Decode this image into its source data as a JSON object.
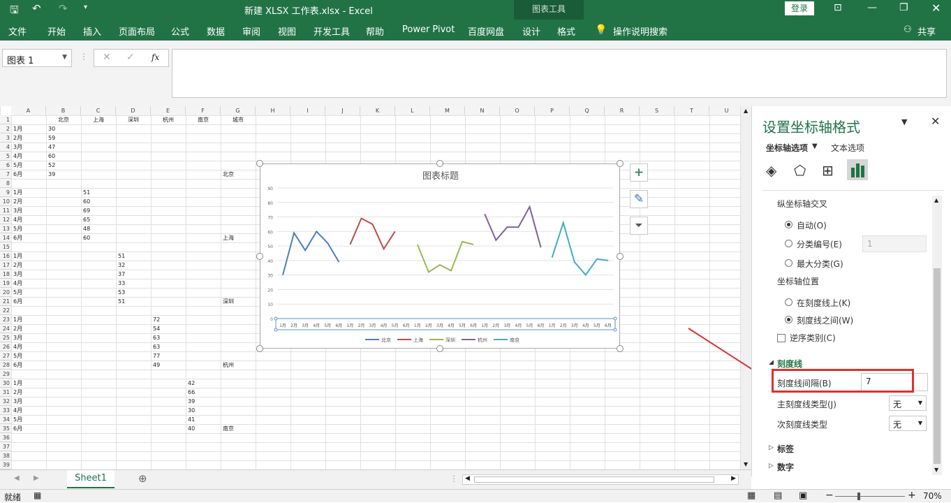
{
  "titlebar": {
    "title": "新建 XLSX 工作表.xlsx  -  Excel",
    "context_tab": "图表工具",
    "login": "登录"
  },
  "ribbon": {
    "tabs": [
      "文件",
      "开始",
      "插入",
      "页面布局",
      "公式",
      "数据",
      "审阅",
      "视图",
      "开发工具",
      "帮助",
      "Power Pivot",
      "百度网盘",
      "设计",
      "格式"
    ],
    "search": "操作说明搜索",
    "share": "共享"
  },
  "formula_bar": {
    "name_box": "图表 1",
    "fx": "fx"
  },
  "columns": [
    "A",
    "B",
    "C",
    "D",
    "E",
    "F",
    "G",
    "H",
    "I",
    "J",
    "K",
    "L",
    "M",
    "N",
    "O",
    "P",
    "Q",
    "R",
    "S",
    "T",
    "U"
  ],
  "rows": [
    "1",
    "2",
    "3",
    "4",
    "5",
    "6",
    "7",
    "8",
    "9",
    "10",
    "11",
    "12",
    "13",
    "14",
    "15",
    "16",
    "17",
    "18",
    "19",
    "20",
    "21",
    "22",
    "23",
    "24",
    "25",
    "26",
    "27",
    "28",
    "29",
    "30",
    "31",
    "32",
    "33",
    "34",
    "35",
    "36",
    "37",
    "38",
    "39"
  ],
  "cells": {
    "headers": [
      "北京",
      "上海",
      "深圳",
      "杭州",
      "南京",
      "城市"
    ],
    "months": [
      "1月",
      "2月",
      "3月",
      "4月",
      "5月",
      "6月"
    ],
    "beijing": [
      "30",
      "59",
      "47",
      "60",
      "52",
      "39"
    ],
    "shanghai": [
      "51",
      "60",
      "69",
      "65",
      "48",
      "60"
    ],
    "shenzhen": [
      "51",
      "32",
      "37",
      "33",
      "53",
      "51"
    ],
    "hangzhou": [
      "72",
      "54",
      "63",
      "63",
      "77",
      "49"
    ],
    "nanjing": [
      "42",
      "66",
      "39",
      "30",
      "41",
      "40"
    ],
    "labels": [
      "北京",
      "上海",
      "深圳",
      "杭州",
      "南京"
    ]
  },
  "chart_data": {
    "type": "line",
    "title": "图表标题",
    "ylim": [
      0,
      90
    ],
    "yticks": [
      "0",
      "10",
      "20",
      "30",
      "40",
      "50",
      "60",
      "70",
      "80",
      "90"
    ],
    "categories": [
      "1月",
      "2月",
      "3月",
      "4月",
      "5月",
      "6月"
    ],
    "series": [
      {
        "name": "北京",
        "color": "#4a7ebb",
        "values": [
          30,
          59,
          47,
          60,
          52,
          39
        ]
      },
      {
        "name": "上海",
        "color": "#be4b48",
        "values": [
          51,
          69,
          65,
          48,
          60
        ]
      },
      {
        "name": "深圳",
        "color": "#98b954",
        "values": [
          51,
          32,
          37,
          33,
          53,
          51
        ]
      },
      {
        "name": "杭州",
        "color": "#7d60a0",
        "values": [
          72,
          54,
          63,
          63,
          77,
          49
        ]
      },
      {
        "name": "南京",
        "color": "#46aac5",
        "values": [
          42,
          66,
          39,
          30,
          41,
          40
        ]
      }
    ],
    "grid": true,
    "legend": "bottom"
  },
  "panel": {
    "title": "设置坐标轴格式",
    "tab_axis": "坐标轴选项",
    "tab_text": "文本选项",
    "cross_heading": "纵坐标轴交叉",
    "radio_auto": "自动(O)",
    "radio_cat": "分类编号(E)",
    "cat_value": "1",
    "radio_max": "最大分类(G)",
    "position_heading": "坐标轴位置",
    "radio_on_tick": "在刻度线上(K)",
    "radio_between": "刻度线之间(W)",
    "reverse": "逆序类别(C)",
    "tick_section": "刻度线",
    "interval_label": "刻度线间隔(B)",
    "interval_value": "7",
    "major_label": "主刻度线类型(J)",
    "major_value": "无",
    "minor_label": "次刻度线类型",
    "minor_value": "无",
    "labels_section": "标签",
    "number_section": "数字"
  },
  "sheet_tab": "Sheet1",
  "status": {
    "ready": "就绪",
    "zoom": "70%"
  },
  "colors": {
    "excel_green": "#217346",
    "highlight_red": "#e03030"
  }
}
